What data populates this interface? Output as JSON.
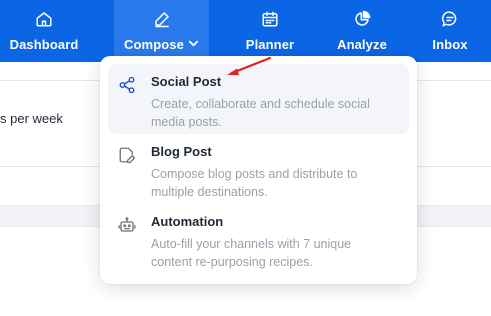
{
  "nav": {
    "items": [
      {
        "label": "Dashboard",
        "icon": "home-icon"
      },
      {
        "label": "Compose",
        "icon": "pencil-icon",
        "active": true
      },
      {
        "label": "Planner",
        "icon": "calendar-icon"
      },
      {
        "label": "Analyze",
        "icon": "pie-chart-icon"
      },
      {
        "label": "Inbox",
        "icon": "chat-bubble-icon"
      }
    ],
    "background": "#0b66e6",
    "active_background": "#2a79ec"
  },
  "background_page": {
    "text": "s per week"
  },
  "compose_menu": {
    "items": [
      {
        "title": "Social Post",
        "description": "Create, collaborate and schedule social media posts.",
        "icon": "share-icon",
        "highlighted": true
      },
      {
        "title": "Blog Post",
        "description": "Compose blog posts and distribute to multiple destinations.",
        "icon": "edit-document-icon"
      },
      {
        "title": "Automation",
        "description": "Auto-fill your channels with 7 unique content re-purposing recipes.",
        "icon": "robot-icon"
      }
    ]
  },
  "annotation": {
    "arrow_color": "#e02424",
    "icon": "red-arrow-icon"
  }
}
